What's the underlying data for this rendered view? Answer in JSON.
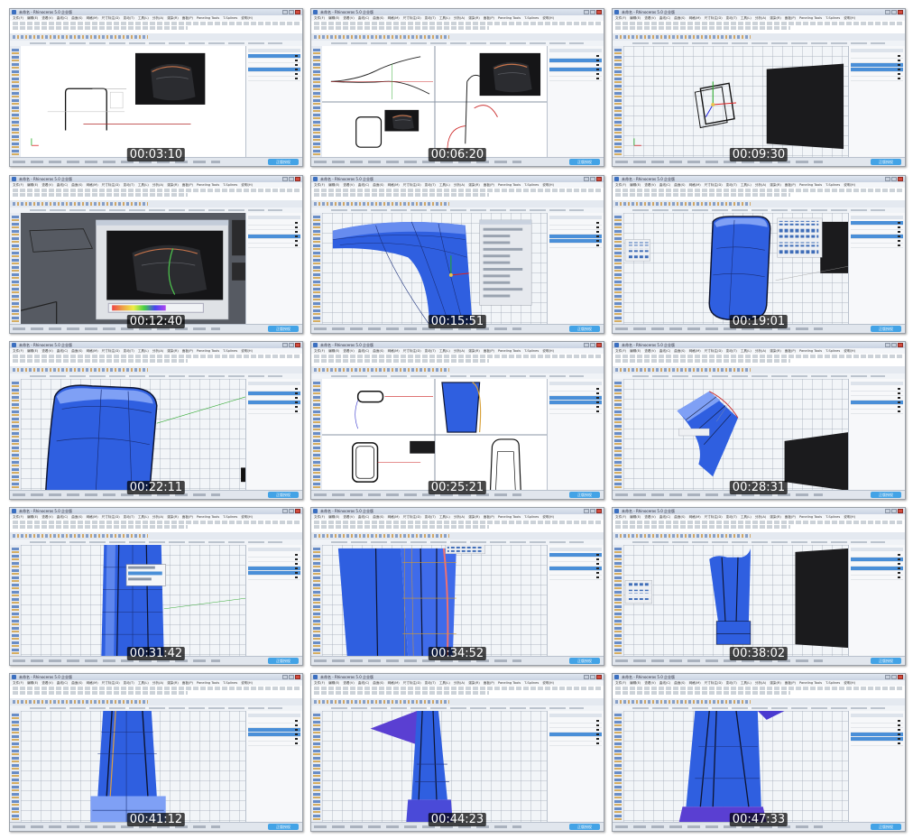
{
  "window": {
    "title": "未命名 - Rhinoceros 5.0 企业版",
    "menu": [
      "文件(F)",
      "编辑(E)",
      "查看(V)",
      "曲线(C)",
      "曲面(S)",
      "网格(M)",
      "尺寸标注(D)",
      "变动(T)",
      "工具(L)",
      "分析(A)",
      "渲染(R)",
      "面板(P)",
      "Paneling Tools",
      "T-Splines",
      "说明(H)"
    ],
    "watermark_text": "正版授权"
  },
  "thumbnails": [
    {
      "time": "00:03:10",
      "scene": "front-sketch"
    },
    {
      "time": "00:06:20",
      "scene": "four-view-curves"
    },
    {
      "time": "00:09:30",
      "scene": "perspective-frame"
    },
    {
      "time": "00:12:40",
      "scene": "dialog-dark"
    },
    {
      "time": "00:15:51",
      "scene": "surface-closeup"
    },
    {
      "time": "00:19:01",
      "scene": "blue-body"
    },
    {
      "time": "00:22:11",
      "scene": "body-top"
    },
    {
      "time": "00:25:21",
      "scene": "four-view-body"
    },
    {
      "time": "00:28:31",
      "scene": "patch-surface"
    },
    {
      "time": "00:31:42",
      "scene": "column-menu"
    },
    {
      "time": "00:34:52",
      "scene": "column-edit"
    },
    {
      "time": "00:38:02",
      "scene": "tall-column"
    },
    {
      "time": "00:41:12",
      "scene": "column-bottom"
    },
    {
      "time": "00:44:23",
      "scene": "column-purple"
    },
    {
      "time": "00:47:33",
      "scene": "column-final"
    }
  ],
  "colors": {
    "surface_blue": "#2f5fe0",
    "surface_light": "#7fa0f5",
    "purple": "#5a3fd2",
    "dark_object": "#1b1b1d",
    "timestamp_bg": "#000000",
    "timestamp_fg": "#ffffff",
    "selection": "#4a8fd8"
  }
}
